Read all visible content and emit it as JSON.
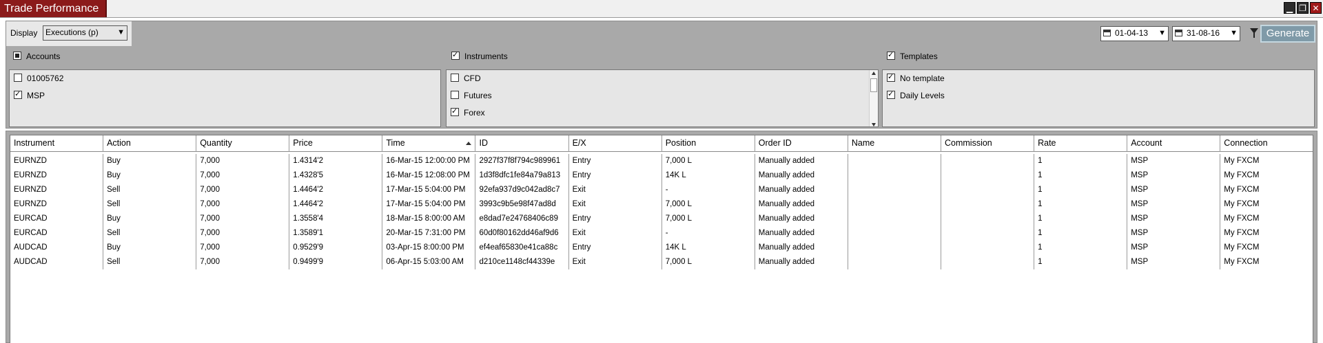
{
  "window": {
    "title": "Trade Performance",
    "buttons": [
      "minimize",
      "restore",
      "close"
    ]
  },
  "filters": {
    "display_label": "Display",
    "display_value": "Executions (p)",
    "date_from": "01-04-13",
    "date_to": "31-08-16",
    "generate_label": "Generate",
    "accounts": {
      "label": "Accounts",
      "state": "partial",
      "items": [
        {
          "label": "01005762",
          "checked": false
        },
        {
          "label": "MSP",
          "checked": true
        }
      ]
    },
    "instruments": {
      "label": "Instruments",
      "state": "checked",
      "items": [
        {
          "label": "CFD",
          "checked": false
        },
        {
          "label": "Futures",
          "checked": false
        },
        {
          "label": "Forex",
          "checked": true
        }
      ]
    },
    "templates": {
      "label": "Templates",
      "state": "checked",
      "items": [
        {
          "label": "No template",
          "checked": true
        },
        {
          "label": "Daily Levels",
          "checked": true
        }
      ]
    }
  },
  "table": {
    "columns": [
      "Instrument",
      "Action",
      "Quantity",
      "Price",
      "Time",
      "ID",
      "E/X",
      "Position",
      "Order ID",
      "Name",
      "Commission",
      "Rate",
      "Account",
      "Connection"
    ],
    "sorted_column": "Time",
    "rows": [
      [
        "EURNZD",
        "Buy",
        "7,000",
        "1.4314'2",
        "16-Mar-15 12:00:00 PM",
        "2927f37f8f794c989961",
        "Entry",
        "7,000 L",
        "Manually added",
        "",
        "",
        "1",
        "MSP",
        "My FXCM"
      ],
      [
        "EURNZD",
        "Buy",
        "7,000",
        "1.4328'5",
        "16-Mar-15 12:08:00 PM",
        "1d3f8dfc1fe84a79a813",
        "Entry",
        "14K L",
        "Manually added",
        "",
        "",
        "1",
        "MSP",
        "My FXCM"
      ],
      [
        "EURNZD",
        "Sell",
        "7,000",
        "1.4464'2",
        "17-Mar-15 5:04:00 PM",
        "92efa937d9c042ad8c7",
        "Exit",
        "-",
        "Manually added",
        "",
        "",
        "1",
        "MSP",
        "My FXCM"
      ],
      [
        "EURNZD",
        "Sell",
        "7,000",
        "1.4464'2",
        "17-Mar-15 5:04:00 PM",
        "3993c9b5e98f47ad8d",
        "Exit",
        "7,000 L",
        "Manually added",
        "",
        "",
        "1",
        "MSP",
        "My FXCM"
      ],
      [
        "EURCAD",
        "Buy",
        "7,000",
        "1.3558'4",
        "18-Mar-15 8:00:00 AM",
        "e8dad7e24768406c89",
        "Entry",
        "7,000 L",
        "Manually added",
        "",
        "",
        "1",
        "MSP",
        "My FXCM"
      ],
      [
        "EURCAD",
        "Sell",
        "7,000",
        "1.3589'1",
        "20-Mar-15 7:31:00 PM",
        "60d0f80162dd46af9d6",
        "Exit",
        "-",
        "Manually added",
        "",
        "",
        "1",
        "MSP",
        "My FXCM"
      ],
      [
        "AUDCAD",
        "Buy",
        "7,000",
        "0.9529'9",
        "03-Apr-15 8:00:00 PM",
        "ef4eaf65830e41ca88c",
        "Entry",
        "14K L",
        "Manually added",
        "",
        "",
        "1",
        "MSP",
        "My FXCM"
      ],
      [
        "AUDCAD",
        "Sell",
        "7,000",
        "0.9499'9",
        "06-Apr-15 5:03:00 AM",
        "d210ce1148cf44339e",
        "Exit",
        "7,000 L",
        "Manually added",
        "",
        "",
        "1",
        "MSP",
        "My FXCM"
      ]
    ]
  }
}
